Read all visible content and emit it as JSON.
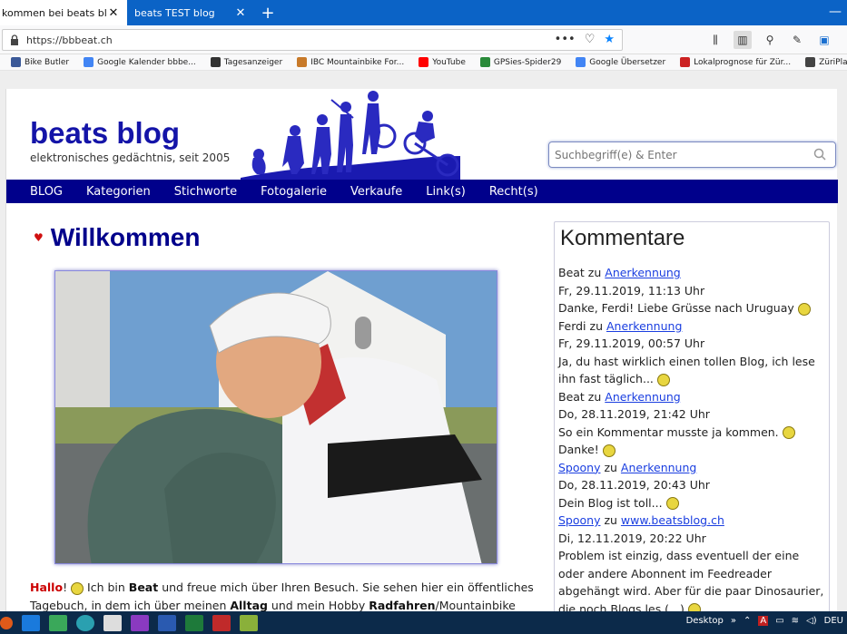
{
  "browser": {
    "tabs": [
      {
        "title": "kommen bei beats blog",
        "active": true
      },
      {
        "title": "beats TEST blog",
        "active": false
      }
    ],
    "url": "https://bbbeat.ch",
    "bookmarks": [
      {
        "label": "Bike Butler",
        "color": "#3b5998"
      },
      {
        "label": "Google Kalender bbbe...",
        "color": "#4285f4"
      },
      {
        "label": "Tagesanzeiger",
        "color": "#333333"
      },
      {
        "label": "IBC Mountainbike For...",
        "color": "#c87a2a"
      },
      {
        "label": "YouTube",
        "color": "#ff0000"
      },
      {
        "label": "GPSies-Spider29",
        "color": "#2a8a3a"
      },
      {
        "label": "Google Übersetzer",
        "color": "#4285f4"
      },
      {
        "label": "Lokalprognose für Zür...",
        "color": "#cc2222"
      },
      {
        "label": "ZüriPlan",
        "color": "#444444"
      }
    ]
  },
  "site": {
    "brand": "beats blog",
    "tagline": "elektronisches gedächtnis, seit 2005",
    "search_placeholder": "Suchbegriff(e) & Enter",
    "menu": [
      "BLOG",
      "Kategorien",
      "Stichworte",
      "Fotogalerie",
      "Verkaufe",
      "Link(s)",
      "Recht(s)"
    ],
    "accent": "#00008b"
  },
  "post": {
    "title": "Willkommen",
    "greeting": "Hallo",
    "intro_1": " Ich bin ",
    "name": "Beat",
    "intro_2": " und freue mich über Ihren Besuch. Sie sehen hier ein öffentliches Tagebuch, in dem ich über meinen ",
    "alltag": "Alltag",
    "intro_3": " und mein Hobby ",
    "radfahren": "Radfahren",
    "intro_4": "/Mountainbike"
  },
  "comments": {
    "heading": "Kommentare",
    "items": [
      {
        "author": "Beat",
        "zu": " zu ",
        "post": "Anerkennung",
        "author_link": false,
        "date": "Fr, 29.11.2019, 11:13 Uhr",
        "text": "Danke, Ferdi! Liebe Grüsse nach Uruguay"
      },
      {
        "author": "Ferdi",
        "zu": " zu ",
        "post": "Anerkennung",
        "author_link": false,
        "date": "Fr, 29.11.2019, 00:57 Uhr",
        "text": "Ja, du hast wirklich einen tollen Blog, ich lese ihn fast täglich..."
      },
      {
        "author": "Beat",
        "zu": " zu ",
        "post": "Anerkennung",
        "author_link": false,
        "date": "Do, 28.11.2019, 21:42 Uhr",
        "text": "So ein Kommentar musste ja kommen.",
        "text2": "Danke!"
      },
      {
        "author": "Spoony",
        "zu": " zu ",
        "post": "Anerkennung",
        "author_link": true,
        "date": "Do, 28.11.2019, 20:43 Uhr",
        "text": "Dein Blog ist toll..."
      },
      {
        "author": "Spoony",
        "zu": " zu ",
        "post": "www.beatsblog.ch",
        "author_link": true,
        "date": "Di, 12.11.2019, 20:22 Uhr",
        "text": "Problem ist einzig, dass eventuell der eine oder andere Abonnent im Feedreader abgehängt wird. Aber für die paar Dinosaurier, die noch Blogs les (...)"
      }
    ]
  },
  "taskbar": {
    "desktop_label": "Desktop",
    "lang": "DEU"
  }
}
